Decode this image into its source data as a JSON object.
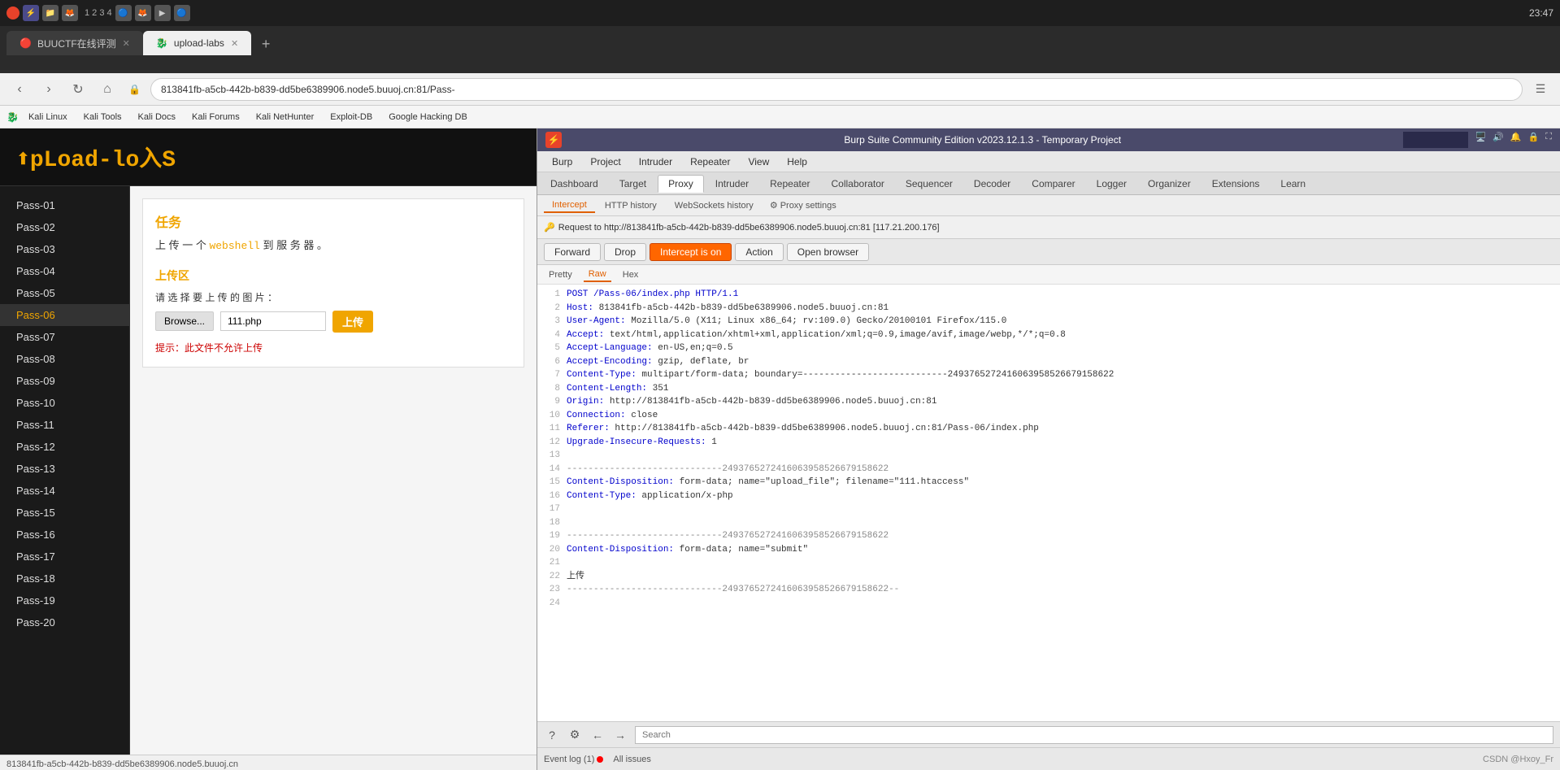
{
  "browser": {
    "title": "upload-labs",
    "time": "23:47",
    "tabs": [
      {
        "id": "tab1",
        "label": "BUUCTF在线评测",
        "active": false,
        "favicon": "🔴"
      },
      {
        "id": "tab2",
        "label": "upload-labs",
        "active": true,
        "favicon": "🐉"
      }
    ],
    "address": "813841fb-a5cb-442b-b839-dd5be6389906.node5.buuoj.cn:81/Pass-",
    "bookmarks": [
      {
        "label": "Kali Linux"
      },
      {
        "label": "Kali Tools"
      },
      {
        "label": "Kali Docs"
      },
      {
        "label": "Kali Forums"
      },
      {
        "label": "Kali NetHunter"
      },
      {
        "label": "Exploit-DB"
      },
      {
        "label": "Google Hacking DB"
      }
    ]
  },
  "webpage": {
    "logo": "⬆pLoad-lo入S",
    "status_bar": "813841fb-a5cb-442b-b839-dd5be6389906.node5.buuoj.cn",
    "nav_items": [
      "Pass-01",
      "Pass-02",
      "Pass-03",
      "Pass-04",
      "Pass-05",
      "Pass-06",
      "Pass-07",
      "Pass-08",
      "Pass-09",
      "Pass-10",
      "Pass-11",
      "Pass-12",
      "Pass-13",
      "Pass-14",
      "Pass-15",
      "Pass-16",
      "Pass-17",
      "Pass-18",
      "Pass-19",
      "Pass-20"
    ],
    "active_nav": "Pass-06",
    "task_title": "任务",
    "task_desc": "上 传 一 个 webshell 到 服 务 器 。",
    "upload_title": "上传区",
    "upload_label": "请 选 择 要 上 传 的 图 片 ：",
    "browse_label": "Browse...",
    "file_name": "111.php",
    "upload_btn_label": "上传",
    "hint": "提示：此文件不允许上传"
  },
  "burp": {
    "title": "Burp Suite Community Edition v2023.12.1.3 - Temporary Project",
    "menu_items": [
      "Burp",
      "Project",
      "Intruder",
      "Repeater",
      "View",
      "Help"
    ],
    "nav_tabs": [
      "Dashboard",
      "Target",
      "Proxy",
      "Intruder",
      "Repeater",
      "Collaborator",
      "Sequencer",
      "Decoder",
      "Comparer",
      "Logger",
      "Organizer",
      "Extensions",
      "Learn"
    ],
    "active_nav_tab": "Proxy",
    "proxy_tabs": [
      "Intercept",
      "HTTP history",
      "WebSockets history"
    ],
    "active_proxy_tab": "Intercept",
    "proxy_settings": "Proxy settings",
    "request_info": "Request to http://813841fb-a5cb-442b-b839-dd5be6389906.node5.buuoj.cn:81 [117.21.200.176]",
    "toolbar_buttons": [
      "Forward",
      "Drop",
      "Intercept is on",
      "Action",
      "Open browser"
    ],
    "request_tabs": [
      "Pretty",
      "Raw",
      "Hex"
    ],
    "active_request_tab": "Raw",
    "request_lines": [
      {
        "num": 1,
        "text": "POST /Pass-06/index.php HTTP/1.1"
      },
      {
        "num": 2,
        "text": "Host: 813841fb-a5cb-442b-b839-dd5be6389906.node5.buuoj.cn:81"
      },
      {
        "num": 3,
        "text": "User-Agent: Mozilla/5.0 (X11; Linux x86_64; rv:109.0) Gecko/20100101 Firefox/115.0"
      },
      {
        "num": 4,
        "text": "Accept: text/html,application/xhtml+xml,application/xml;q=0.9,image/avif,image/webp,*/*;q=0.8"
      },
      {
        "num": 5,
        "text": "Accept-Language: en-US,en;q=0.5"
      },
      {
        "num": 6,
        "text": "Accept-Encoding: gzip, deflate, br"
      },
      {
        "num": 7,
        "text": "Content-Type: multipart/form-data; boundary=---------------------------2493765272416063958526679158622"
      },
      {
        "num": 8,
        "text": "Content-Length: 351"
      },
      {
        "num": 9,
        "text": "Origin: http://813841fb-a5cb-442b-b839-dd5be6389906.node5.buuoj.cn:81"
      },
      {
        "num": 10,
        "text": "Connection: close"
      },
      {
        "num": 11,
        "text": "Referer: http://813841fb-a5cb-442b-b839-dd5be6389906.node5.buuoj.cn:81/Pass-06/index.php"
      },
      {
        "num": 12,
        "text": "Upgrade-Insecure-Requests: 1"
      },
      {
        "num": 13,
        "text": ""
      },
      {
        "num": 14,
        "text": "-----------------------------2493765272416063958526679158622"
      },
      {
        "num": 15,
        "text": "Content-Disposition: form-data; name=\"upload_file\"; filename=\"111.htaccess\""
      },
      {
        "num": 16,
        "text": "Content-Type: application/x-php"
      },
      {
        "num": 17,
        "text": ""
      },
      {
        "num": 18,
        "text": ""
      },
      {
        "num": 19,
        "text": "-----------------------------2493765272416063958526679158622"
      },
      {
        "num": 20,
        "text": "Content-Disposition: form-data; name=\"submit\""
      },
      {
        "num": 21,
        "text": ""
      },
      {
        "num": 22,
        "text": "上传"
      },
      {
        "num": 23,
        "text": "-----------------------------2493765272416063958526679158622--"
      },
      {
        "num": 24,
        "text": ""
      }
    ],
    "bottom": {
      "search_placeholder": "Search"
    },
    "status_bar": {
      "event_log": "Event log (1)",
      "all_issues": "All issues",
      "right_text": "CSDN @Hxoy_Fr"
    }
  }
}
